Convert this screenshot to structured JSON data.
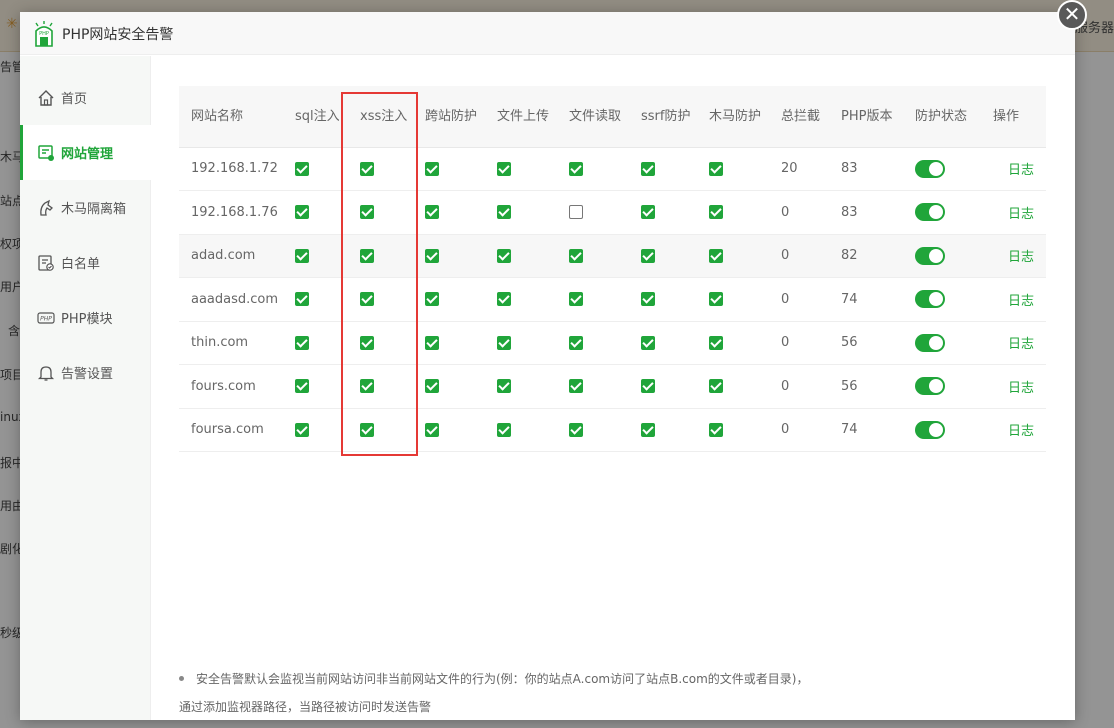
{
  "background": {
    "right_text": "服务器",
    "left_fragments": [
      "告管",
      "木马",
      "站点",
      "权项",
      "用户",
      "含",
      "项目",
      "inux",
      "报中",
      "用由",
      "剧化",
      "秒级"
    ]
  },
  "modal": {
    "title": "PHP网站安全告警",
    "close_label": "✕"
  },
  "sidebar": {
    "items": [
      {
        "label": "首页",
        "icon": "home-icon"
      },
      {
        "label": "网站管理",
        "icon": "site-manage-icon",
        "active": true
      },
      {
        "label": "木马隔离箱",
        "icon": "trojan-quarantine-icon"
      },
      {
        "label": "白名单",
        "icon": "whitelist-icon"
      },
      {
        "label": "PHP模块",
        "icon": "php-module-icon"
      },
      {
        "label": "告警设置",
        "icon": "bell-icon"
      }
    ]
  },
  "table": {
    "headers": [
      "网站名称",
      "sql注入",
      "xss注入",
      "跨站防护",
      "文件上传",
      "文件读取",
      "ssrf防护",
      "木马防护",
      "总拦截",
      "PHP版本",
      "防护状态",
      "操作"
    ],
    "rows": [
      {
        "name": "192.168.1.72",
        "sql": true,
        "xss": true,
        "cross": true,
        "upload": true,
        "read": true,
        "ssrf": true,
        "trojan": true,
        "total": "20",
        "php": "83",
        "status": true,
        "op": "日志"
      },
      {
        "name": "192.168.1.76",
        "sql": true,
        "xss": true,
        "cross": true,
        "upload": true,
        "read": false,
        "ssrf": true,
        "trojan": true,
        "total": "0",
        "php": "83",
        "status": true,
        "op": "日志"
      },
      {
        "name": "adad.com",
        "sql": true,
        "xss": true,
        "cross": true,
        "upload": true,
        "read": true,
        "ssrf": true,
        "trojan": true,
        "total": "0",
        "php": "82",
        "status": true,
        "op": "日志"
      },
      {
        "name": "aaadasd.com",
        "sql": true,
        "xss": true,
        "cross": true,
        "upload": true,
        "read": true,
        "ssrf": true,
        "trojan": true,
        "total": "0",
        "php": "74",
        "status": true,
        "op": "日志"
      },
      {
        "name": "thin.com",
        "sql": true,
        "xss": true,
        "cross": true,
        "upload": true,
        "read": true,
        "ssrf": true,
        "trojan": true,
        "total": "0",
        "php": "56",
        "status": true,
        "op": "日志"
      },
      {
        "name": "fours.com",
        "sql": true,
        "xss": true,
        "cross": true,
        "upload": true,
        "read": true,
        "ssrf": true,
        "trojan": true,
        "total": "0",
        "php": "56",
        "status": true,
        "op": "日志"
      },
      {
        "name": "foursa.com",
        "sql": true,
        "xss": true,
        "cross": true,
        "upload": true,
        "read": true,
        "ssrf": true,
        "trojan": true,
        "total": "0",
        "php": "74",
        "status": true,
        "op": "日志"
      }
    ]
  },
  "notes": {
    "line1": "安全告警默认会监视当前网站访问非当前网站文件的行为(例：你的站点A.com访问了站点B.com的文件或者目录)，",
    "line2": "通过添加监视器路径，当路径被访问时发送告警"
  },
  "colors": {
    "accent": "#20a53a",
    "alert_red": "#ef0808",
    "highlight": "#e53935"
  }
}
